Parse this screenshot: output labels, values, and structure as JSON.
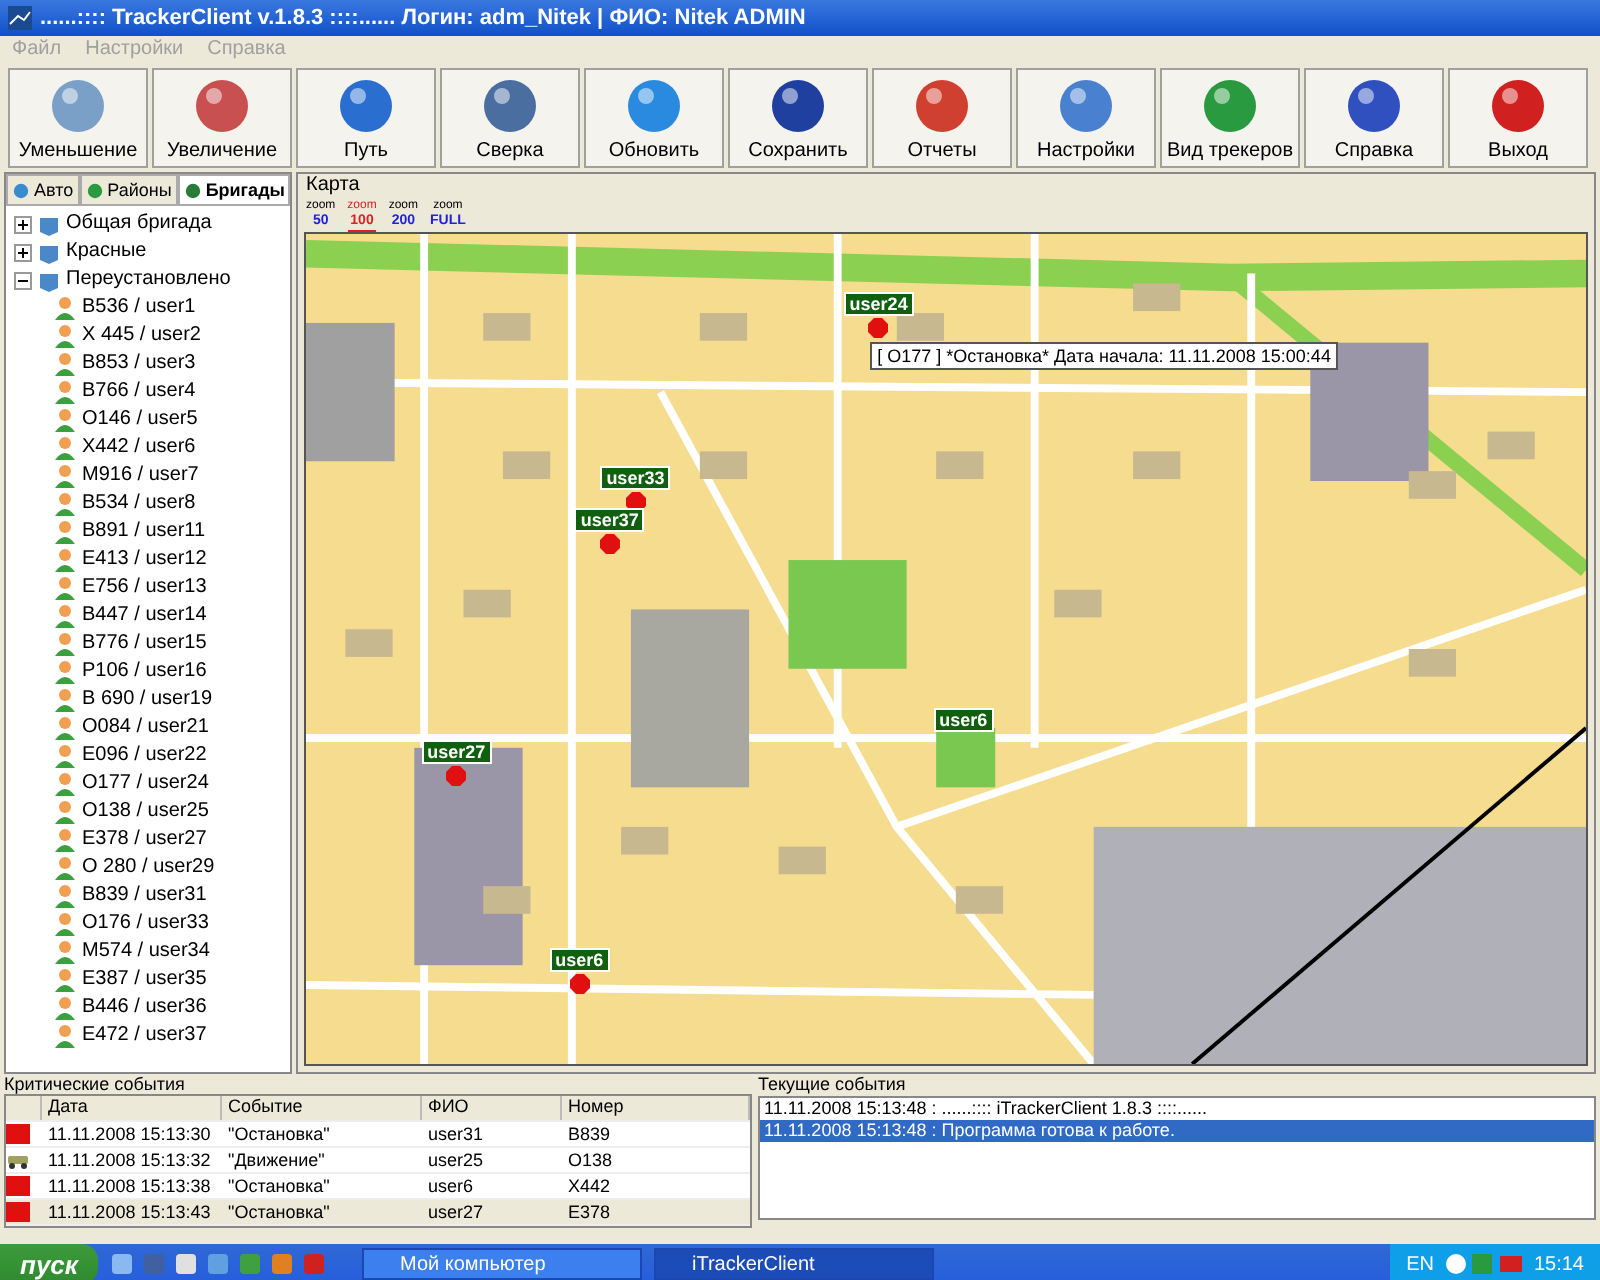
{
  "window": {
    "title": "......:::: TrackerClient v.1.8.3 ::::...... Логин: adm_Nitek | ФИО: Nitek ADMIN"
  },
  "menu": [
    {
      "label": "Файл"
    },
    {
      "label": "Настройки"
    },
    {
      "label": "Справка"
    }
  ],
  "toolbar": [
    {
      "label": "Уменьшение"
    },
    {
      "label": "Увеличение"
    },
    {
      "label": "Путь"
    },
    {
      "label": "Сверка"
    },
    {
      "label": "Обновить"
    },
    {
      "label": "Сохранить"
    },
    {
      "label": "Отчеты"
    },
    {
      "label": "Настройки"
    },
    {
      "label": "Вид трекеров"
    },
    {
      "label": "Справка"
    },
    {
      "label": "Выход"
    }
  ],
  "left_tabs": [
    {
      "label": "Авто",
      "selected": false
    },
    {
      "label": "Районы",
      "selected": false
    },
    {
      "label": "Бригады",
      "selected": true
    }
  ],
  "tree": [
    {
      "label": "Общая бригада",
      "expanded": false
    },
    {
      "label": "Красные",
      "expanded": false
    },
    {
      "label": "Переустановлено",
      "expanded": true,
      "children": [
        {
          "label": "B536 / user1"
        },
        {
          "label": "X 445 / user2"
        },
        {
          "label": "B853 / user3"
        },
        {
          "label": "B766 / user4"
        },
        {
          "label": "O146 / user5"
        },
        {
          "label": "X442 / user6"
        },
        {
          "label": "M916 / user7"
        },
        {
          "label": "B534 / user8"
        },
        {
          "label": "B891 / user11"
        },
        {
          "label": "E413 / user12"
        },
        {
          "label": "E756 / user13"
        },
        {
          "label": "B447 / user14"
        },
        {
          "label": "B776 / user15"
        },
        {
          "label": "P106 / user16"
        },
        {
          "label": "B 690 / user19"
        },
        {
          "label": "O084 / user21"
        },
        {
          "label": "E096 / user22"
        },
        {
          "label": "O177 / user24"
        },
        {
          "label": "O138 / user25"
        },
        {
          "label": "E378 / user27"
        },
        {
          "label": "O 280 / user29"
        },
        {
          "label": "B839 / user31"
        },
        {
          "label": "O176 / user33"
        },
        {
          "label": "M574 / user34"
        },
        {
          "label": "E387 / user35"
        },
        {
          "label": "B446 / user36"
        },
        {
          "label": "E472 / user37"
        }
      ]
    }
  ],
  "map": {
    "title": "Карта",
    "zoom_levels": [
      {
        "caption": "zoom",
        "value": "50",
        "selected": false
      },
      {
        "caption": "zoom",
        "value": "100",
        "selected": true
      },
      {
        "caption": "zoom",
        "value": "200",
        "selected": false
      },
      {
        "caption": "zoom",
        "value": "FULL",
        "selected": false
      }
    ],
    "markers": [
      {
        "label": "user24",
        "stop": true
      },
      {
        "label": "user33",
        "stop": true
      },
      {
        "label": "user37",
        "stop": true
      },
      {
        "label": "user6",
        "stop": false
      },
      {
        "label": "user27",
        "stop": true
      },
      {
        "label": "user6",
        "stop": true
      }
    ],
    "tooltip": "[ O177 ] *Остановка* Дата начала: 11.11.2008 15:00:44"
  },
  "critical_events": {
    "title": "Критические события",
    "columns": [
      "Дата",
      "Событие",
      "ФИО",
      "Номер"
    ],
    "rows": [
      {
        "kind": "stop",
        "date": "11.11.2008 15:13:30",
        "event": "\"Остановка\"",
        "name": "user31",
        "number": "B839",
        "selected": false
      },
      {
        "kind": "move",
        "date": "11.11.2008 15:13:32",
        "event": "\"Движение\"",
        "name": "user25",
        "number": "O138",
        "selected": false
      },
      {
        "kind": "stop",
        "date": "11.11.2008 15:13:38",
        "event": "\"Остановка\"",
        "name": "user6",
        "number": "X442",
        "selected": false
      },
      {
        "kind": "stop",
        "date": "11.11.2008 15:13:43",
        "event": "\"Остановка\"",
        "name": "user27",
        "number": "E378",
        "selected": true
      }
    ]
  },
  "current_events": {
    "title": "Текущие события",
    "items": [
      {
        "text": "11.11.2008 15:13:48 : ......:::: iTrackerClient 1.8.3 ::::......",
        "selected": false
      },
      {
        "text": "11.11.2008 15:13:48 : Программа готова к работе.",
        "selected": true
      }
    ]
  },
  "taskbar": {
    "start": "пуск",
    "tasks": [
      {
        "label": "Мой компьютер",
        "selected": false
      },
      {
        "label": "iTrackerClient",
        "selected": true
      }
    ],
    "language": "EN",
    "clock": "15:14"
  }
}
